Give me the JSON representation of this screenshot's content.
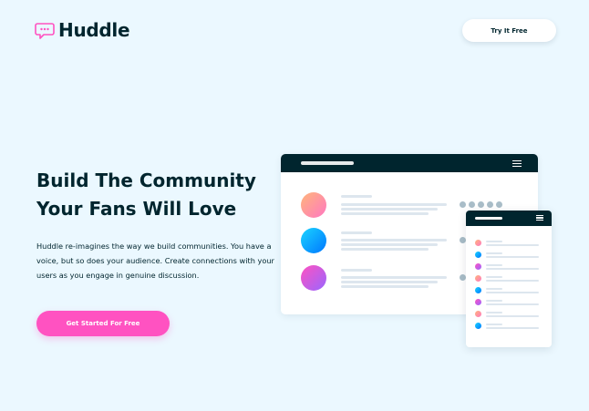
{
  "header": {
    "brand": "Huddle",
    "cta_label": "Try It Free"
  },
  "hero": {
    "title": "Build The Community Your Fans Will Love",
    "description": "Huddle re-imagines the way we build communities. You have a voice, but so does your audience. Create connections with your users as you engage in genuine discussion.",
    "cta_label": "Get Started For Free"
  },
  "colors": {
    "background": "#ebf8ff",
    "brand_dark": "#00252e",
    "accent_pink": "#ff52c1"
  },
  "icons": {
    "logo": "chat-bubble-icon",
    "menu": "hamburger-icon"
  }
}
